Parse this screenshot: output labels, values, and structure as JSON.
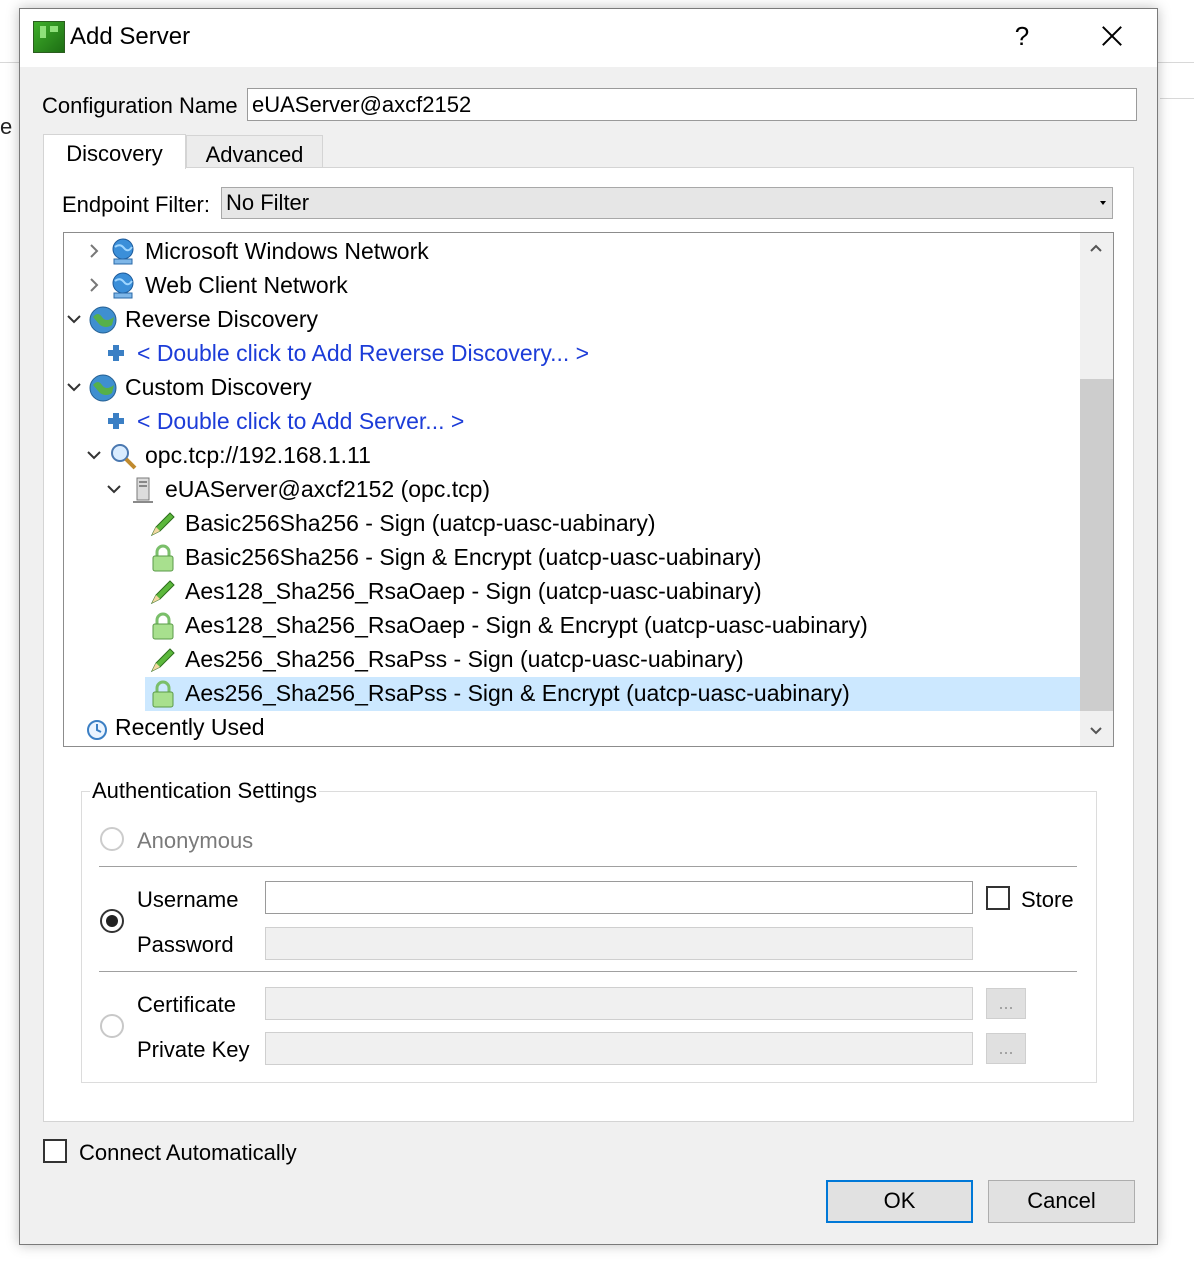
{
  "background": {
    "partial_letter": "e"
  },
  "window": {
    "title": "Add Server",
    "help": "?"
  },
  "config": {
    "label": "Configuration Name",
    "value": "eUAServer@axcf2152"
  },
  "tabs": [
    {
      "label": "Discovery",
      "active": true
    },
    {
      "label": "Advanced",
      "active": false
    }
  ],
  "filter": {
    "label": "Endpoint Filter:",
    "value": "No Filter"
  },
  "tree": {
    "microsoft_network": "Microsoft Windows Network",
    "web_client_network": "Web Client Network",
    "reverse_discovery": "Reverse Discovery",
    "add_reverse": "< Double click to Add Reverse Discovery... >",
    "custom_discovery": "Custom Discovery",
    "add_server": "< Double click to Add Server... >",
    "url": "opc.tcp://192.168.1.11",
    "server": "eUAServer@axcf2152 (opc.tcp)",
    "endpoints": [
      "Basic256Sha256 - Sign (uatcp-uasc-uabinary)",
      "Basic256Sha256 - Sign & Encrypt (uatcp-uasc-uabinary)",
      "Aes128_Sha256_RsaOaep - Sign (uatcp-uasc-uabinary)",
      "Aes128_Sha256_RsaOaep - Sign & Encrypt (uatcp-uasc-uabinary)",
      "Aes256_Sha256_RsaPss - Sign (uatcp-uasc-uabinary)",
      "Aes256_Sha256_RsaPss - Sign & Encrypt (uatcp-uasc-uabinary)"
    ],
    "recently_used": "Recently Used"
  },
  "auth": {
    "title": "Authentication Settings",
    "anonymous": "Anonymous",
    "username_label": "Username",
    "username_value": "",
    "password_label": "Password",
    "store_label": "Store",
    "certificate_label": "Certificate",
    "private_key_label": "Private Key",
    "browse": "..."
  },
  "connect_auto": "Connect Automatically",
  "buttons": {
    "ok": "OK",
    "cancel": "Cancel"
  },
  "colors": {
    "link": "#1c3cd8",
    "selection": "#cce8ff",
    "accent": "#0078d7"
  }
}
